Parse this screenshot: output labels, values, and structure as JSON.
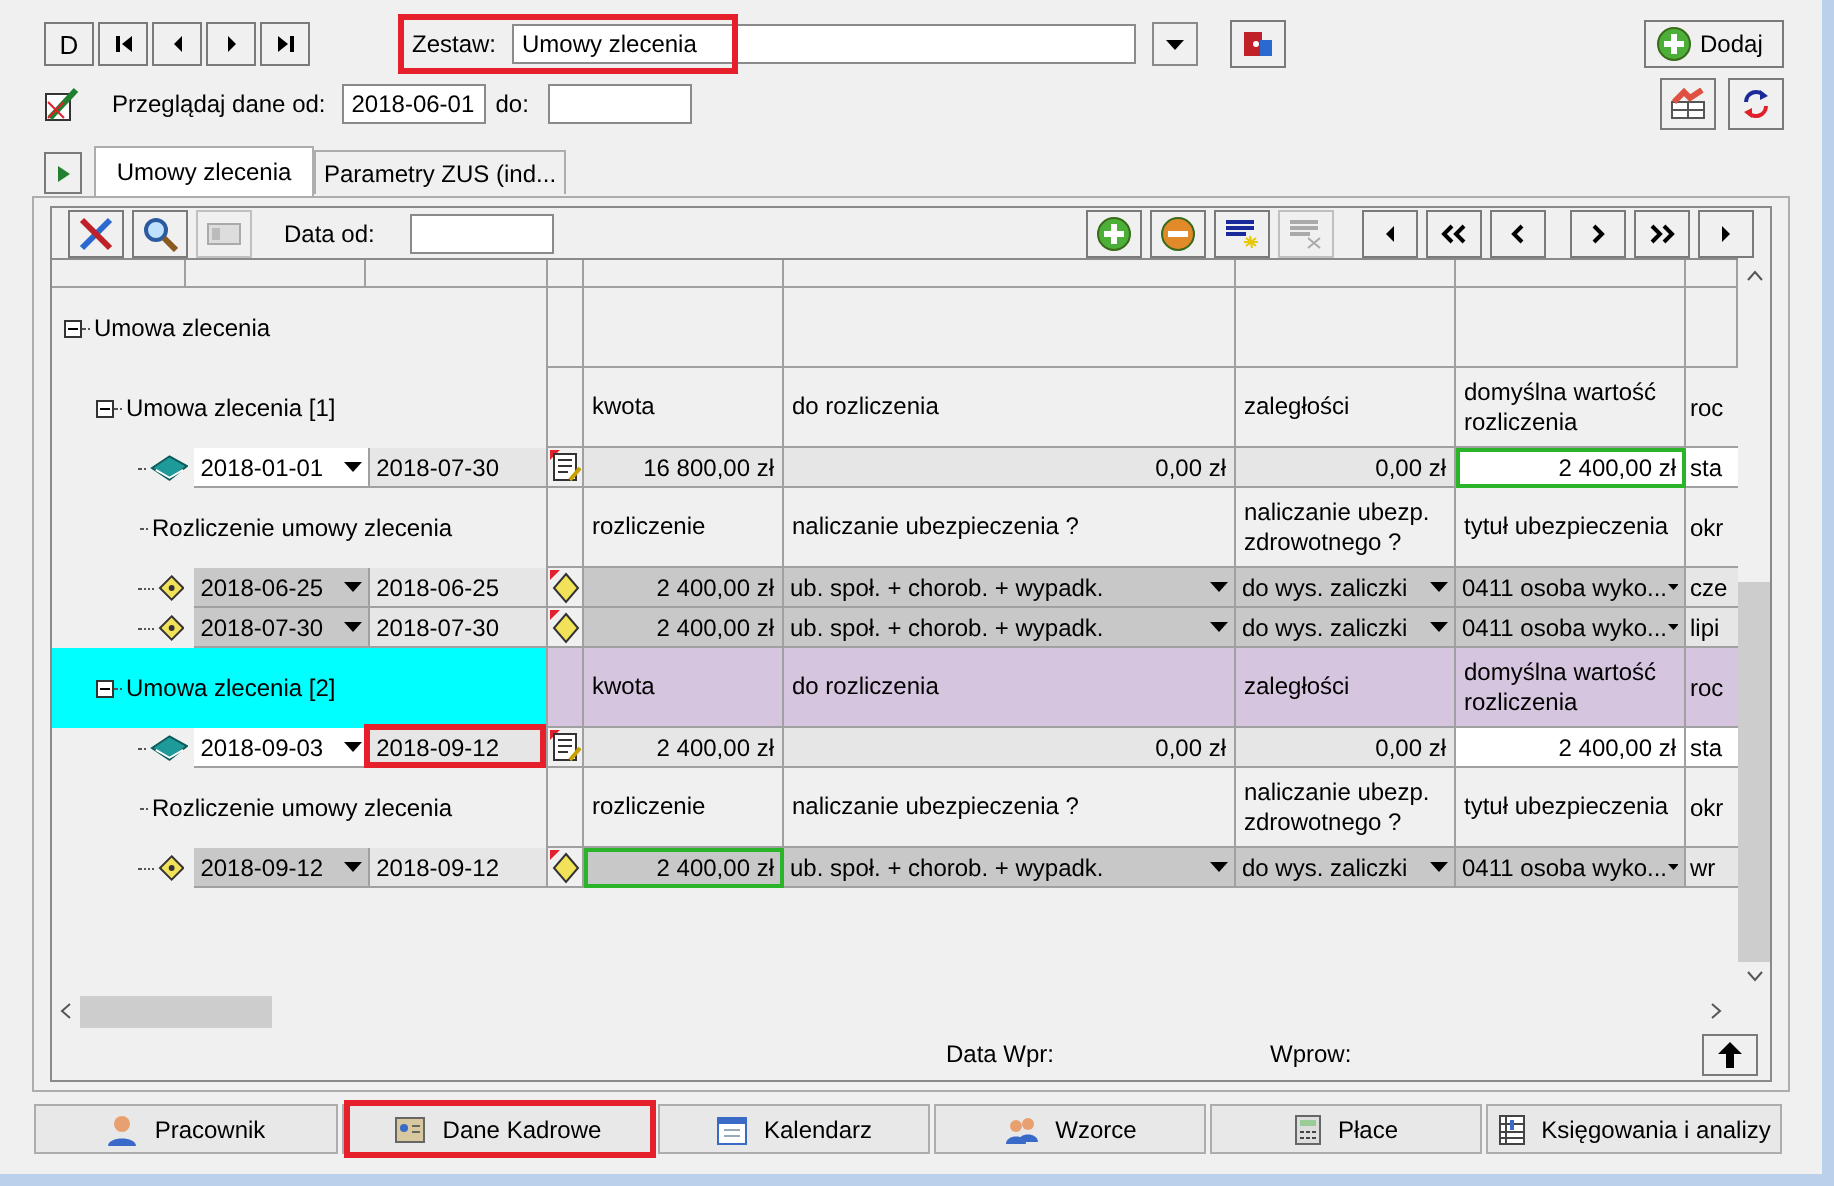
{
  "record_nav": {
    "new_label": "D"
  },
  "set": {
    "label": "Zestaw:",
    "value": "Umowy zlecenia",
    "highlighted": true
  },
  "add_button": "Dodaj",
  "browse": {
    "label": "Przeglądaj dane od:",
    "from": "2018-06-01",
    "to_label": "do:"
  },
  "tabs": [
    {
      "label": "Umowy zlecenia",
      "selected": true
    },
    {
      "label": "Parametry ZUS (ind...",
      "selected": false
    }
  ],
  "grid_toolbar": {
    "date_label": "Data od:"
  },
  "rows": [
    {
      "kind": "group",
      "label": "Umowa zlecenia",
      "expanded": true
    },
    {
      "kind": "header",
      "label": "Umowa zlecenia [1]",
      "expanded": true,
      "selected": false,
      "cells": [
        "kwota",
        "do rozliczenia",
        "zaległości",
        "domyślna wartość rozliczenia",
        "roc"
      ]
    },
    {
      "kind": "contract",
      "from": "2018-01-01",
      "to": "2018-07-30",
      "highlighted": false,
      "cells": [
        "16 800,00 zł",
        "0,00 zł",
        "0,00 zł",
        "2 400,00 zł",
        "sta"
      ]
    },
    {
      "kind": "settlement-header",
      "label": "Rozliczenie umowy zlecenia",
      "cells": [
        "rozliczenie",
        "naliczanie ubezpieczenia ?",
        "naliczanie ubezp. zdrowotnego ?",
        "tytuł ubezpieczenia",
        "okr"
      ]
    },
    {
      "kind": "settlement",
      "from": "2018-06-25",
      "to": "2018-06-25",
      "cells": [
        "2 400,00 zł",
        "ub. społ. + chorob. + wypadk.",
        "do wys. zaliczki",
        "0411 osoba wyko...",
        "cze"
      ]
    },
    {
      "kind": "settlement",
      "from": "2018-07-30",
      "to": "2018-07-30",
      "cells": [
        "2 400,00 zł",
        "ub. społ. + chorob. + wypadk.",
        "do wys. zaliczki",
        "0411 osoba wyko...",
        "lipi"
      ]
    },
    {
      "kind": "header",
      "label": "Umowa zlecenia [2]",
      "expanded": true,
      "selected": true,
      "cells": [
        "kwota",
        "do rozliczenia",
        "zaległości",
        "domyślna wartość rozliczenia",
        "roc"
      ]
    },
    {
      "kind": "contract",
      "from": "2018-09-03",
      "to": "2018-09-12",
      "highlighted": true,
      "cells": [
        "2 400,00 zł",
        "0,00 zł",
        "0,00 zł",
        "2 400,00 zł",
        "sta"
      ]
    },
    {
      "kind": "settlement-header",
      "label": "Rozliczenie umowy zlecenia",
      "cells": [
        "rozliczenie",
        "naliczanie ubezpieczenia ?",
        "naliczanie ubezp. zdrowotnego ?",
        "tytuł ubezpieczenia",
        "okr"
      ]
    },
    {
      "kind": "settlement",
      "from": "2018-09-12",
      "to": "2018-09-12",
      "cells": [
        "2 400,00 zł",
        "ub. społ. + chorob. + wypadk.",
        "do wys. zaliczki",
        "0411 osoba wyko...",
        "wr"
      ]
    }
  ],
  "footer": {
    "entered_date_label": "Data Wpr:",
    "entered_by_label": "Wprow:"
  },
  "modules": [
    {
      "label": "Pracownik",
      "highlighted": false
    },
    {
      "label": "Dane Kadrowe",
      "highlighted": true
    },
    {
      "label": "Kalendarz",
      "highlighted": false
    },
    {
      "label": "Wzorce",
      "highlighted": false
    },
    {
      "label": "Płace",
      "highlighted": false
    },
    {
      "label": "Księgowania i analizy",
      "highlighted": false
    }
  ]
}
